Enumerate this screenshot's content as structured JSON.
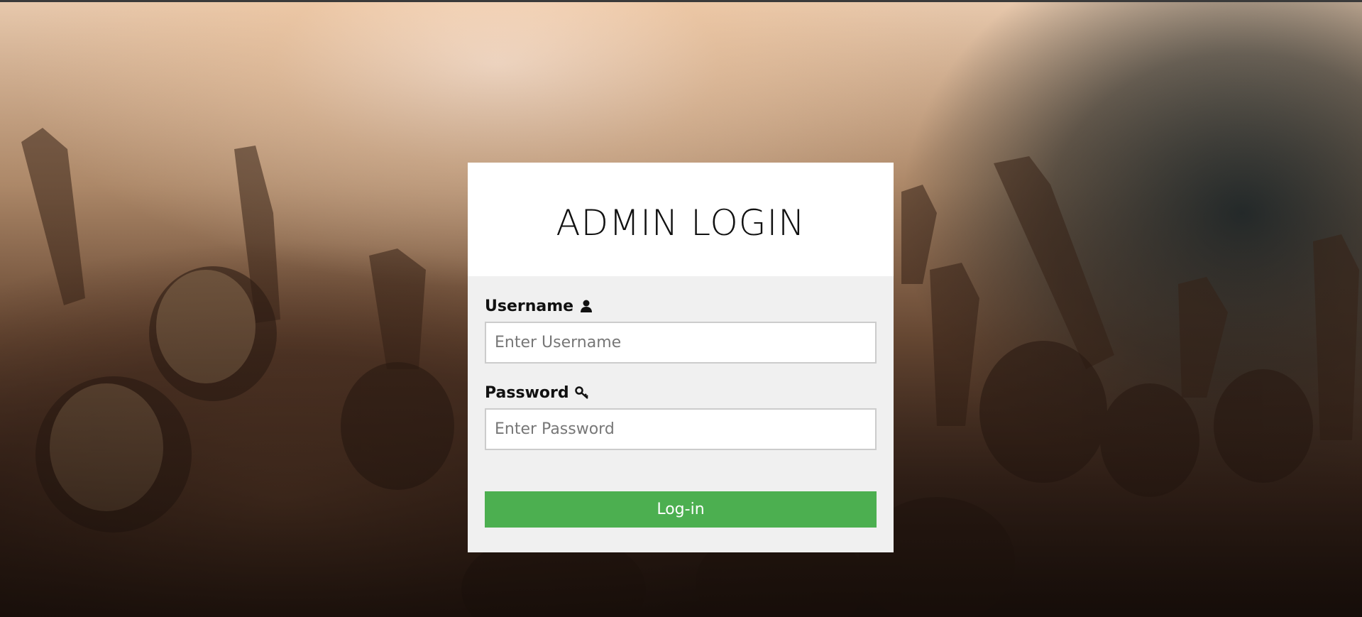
{
  "login_card": {
    "title": "ADMIN LOGIN",
    "username": {
      "label": "Username",
      "placeholder": "Enter Username",
      "value": "",
      "icon": "user-icon"
    },
    "password": {
      "label": "Password",
      "placeholder": "Enter Password",
      "value": "",
      "icon": "key-icon"
    },
    "submit_label": "Log-in"
  },
  "colors": {
    "button": "#4caf50",
    "card_header": "#ffffff",
    "card_body": "#f0f0f0"
  }
}
